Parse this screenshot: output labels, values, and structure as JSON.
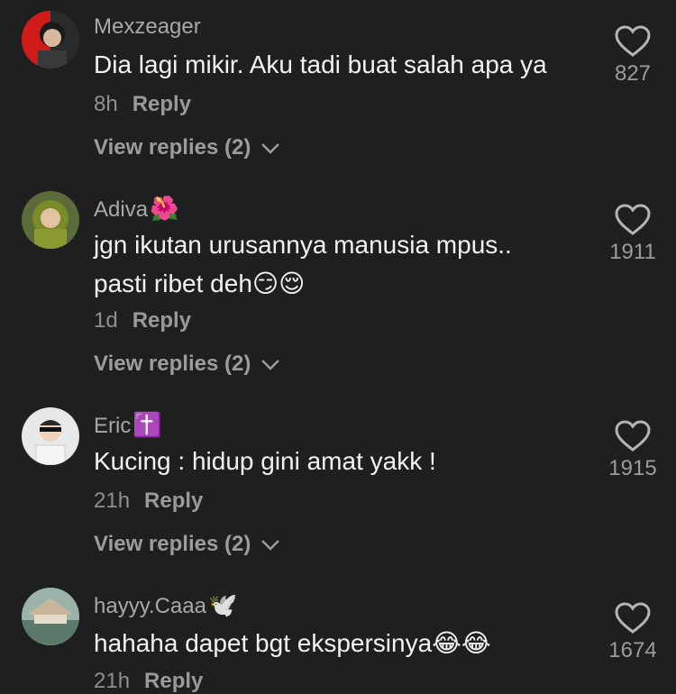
{
  "comments": [
    {
      "username": "Mexzeager",
      "badge": "",
      "text_lines": [
        "Dia lagi mikir. Aku tadi buat salah apa ya"
      ],
      "time": "8h",
      "reply_label": "Reply",
      "view_replies": "View replies (2)",
      "likes": "827"
    },
    {
      "username": "Adiva",
      "badge": "🌺",
      "text_lines": [
        "jgn ikutan urusannya manusia mpus..",
        "pasti ribet deh😏😌"
      ],
      "time": "1d",
      "reply_label": "Reply",
      "view_replies": "View replies (2)",
      "likes": "1911"
    },
    {
      "username": "Eric",
      "badge": "✝️",
      "text_lines": [
        "Kucing : hidup gini amat yakk !"
      ],
      "time": "21h",
      "reply_label": "Reply",
      "view_replies": "View replies (2)",
      "likes": "1915"
    },
    {
      "username": "hayyy.Caaa",
      "badge": "🕊️",
      "text_lines": [
        "hahaha dapet bgt ekspersinya😂😂"
      ],
      "time": "21h",
      "reply_label": "Reply",
      "view_replies": "",
      "likes": "1674"
    }
  ],
  "icons": {
    "like": "heart-outline-icon",
    "expand": "chevron-down-icon"
  },
  "colors": {
    "background": "#1f1f1f",
    "username": "#a8a8a8",
    "text": "#f2f2f2",
    "meta": "#8f8f8f"
  }
}
